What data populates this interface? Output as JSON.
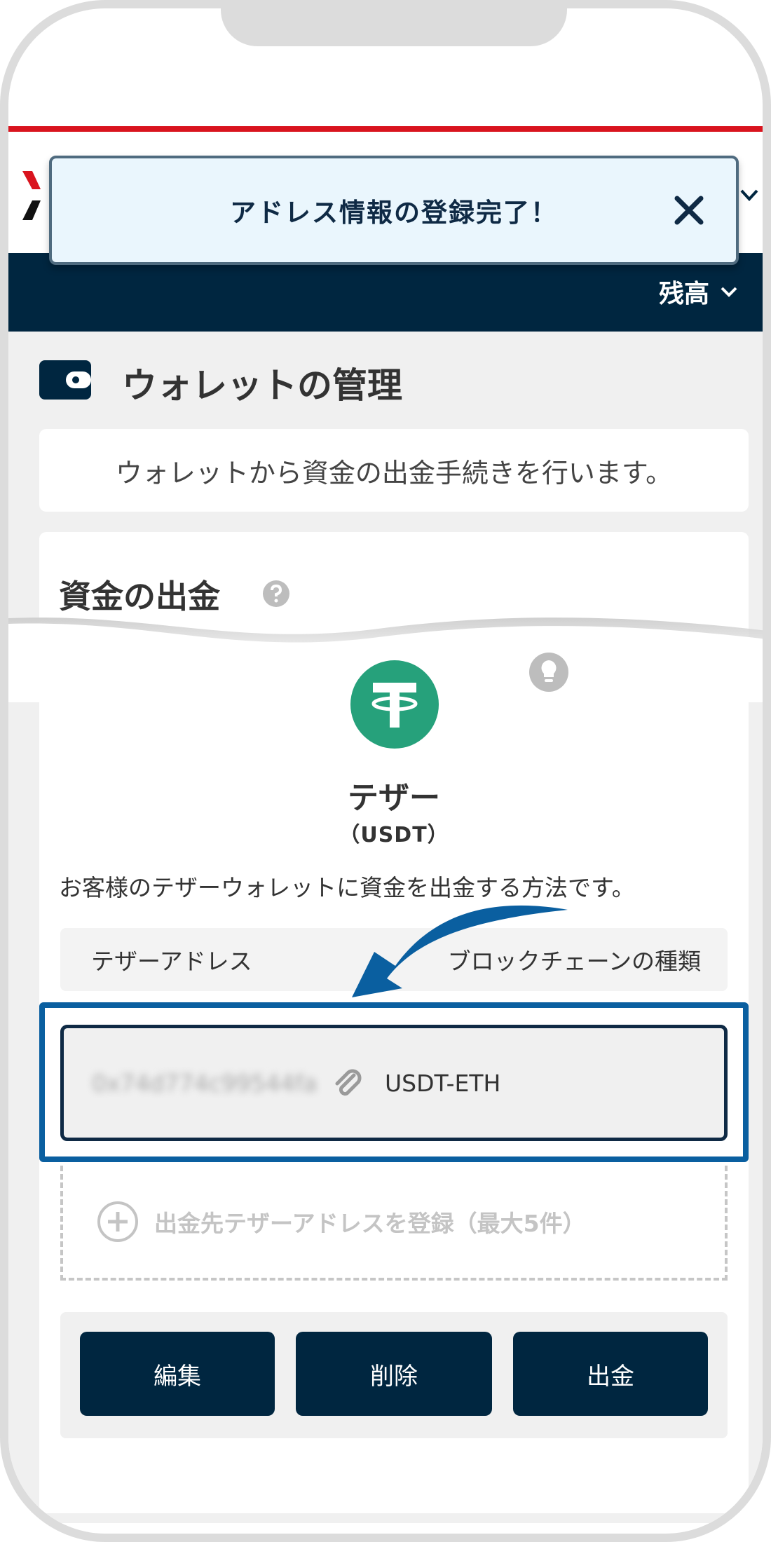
{
  "toast": {
    "message": "アドレス情報の登録完了！",
    "close_icon": "close-icon"
  },
  "header": {
    "balance_label": "残高"
  },
  "page": {
    "title": "ウォレットの管理",
    "description": "ウォレットから資金の出金手続きを行います。"
  },
  "withdraw": {
    "section_title": "資金の出金",
    "coin_name": "テザー",
    "coin_ticker": "（USDT）",
    "coin_description": "お客様のテザーウォレットに資金を出金する方法です。",
    "columns": [
      "テザーアドレス",
      "ブロックチェーンの種類"
    ],
    "address": {
      "value": "0x74d774c99544fa...",
      "chain": "USDT-ETH"
    },
    "register_label": "出金先テザーアドレスを登録（最大5件）",
    "buttons": {
      "edit": "編集",
      "delete": "削除",
      "withdraw": "出金"
    }
  },
  "colors": {
    "navy": "#002640",
    "accent_red": "#d9141e",
    "tether_green": "#26a17b",
    "highlight_blue": "#0a5fa0"
  }
}
